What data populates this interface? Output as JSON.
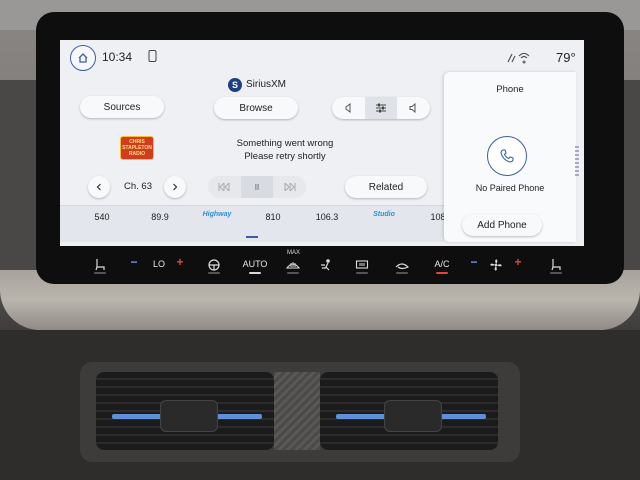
{
  "status_bar": {
    "time": "10:34",
    "temperature": "79°"
  },
  "media": {
    "provider": "SiriusXM",
    "provider_logo_letter": "S",
    "sources_label": "Sources",
    "browse_label": "Browse",
    "error_line1": "Something went wrong",
    "error_line2": "Please retry shortly",
    "channel": "Ch. 63",
    "related_label": "Related",
    "station_art_text": "CHRIS STAPLETON RADIO",
    "presets": [
      "540",
      "89.9",
      "810",
      "106.3",
      "108"
    ],
    "preset_logos": [
      "Highway",
      "Studio"
    ],
    "pause_glyph": "II"
  },
  "phone": {
    "title": "Phone",
    "status": "No Paired Phone",
    "add_label": "Add Phone"
  },
  "climate": {
    "driver_temp": "LO",
    "auto_label": "AUTO",
    "max_label": "MAX",
    "ac_label": "A/C",
    "minus": "−",
    "plus": "+"
  },
  "colors": {
    "accent": "#3b5fa3",
    "plus_red": "#e0463a",
    "minus_blue": "#6e9cf2",
    "screen_bg": "#eef0f4"
  }
}
